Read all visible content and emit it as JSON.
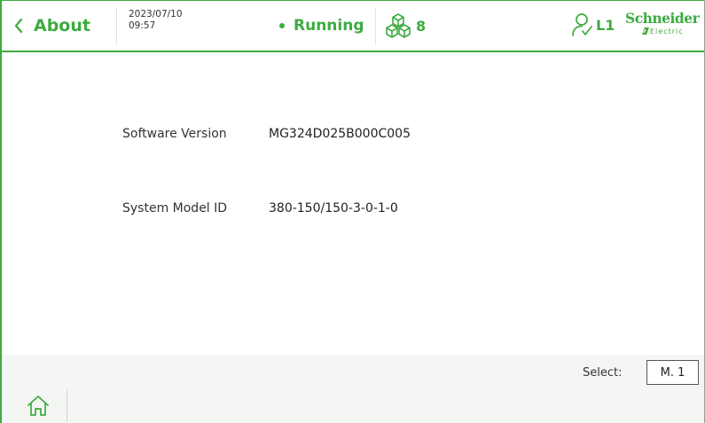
{
  "header": {
    "back_label": "About",
    "date": "2023/07/10",
    "time": "09:57",
    "status": "Running",
    "boxes_count": "8",
    "user_level": "L1",
    "brand_name": "Schneider",
    "brand_sub": "Electric",
    "accent_color": "#3dab3f"
  },
  "info": {
    "software_version_label": "Software Version",
    "software_version_value": "MG324D025B000C005",
    "system_model_label": "System Model ID",
    "system_model_value": "380-150/150-3-0-1-0"
  },
  "footer": {
    "select_label": "Select:",
    "select_value": "M. 1",
    "home_icon": "home-icon"
  }
}
